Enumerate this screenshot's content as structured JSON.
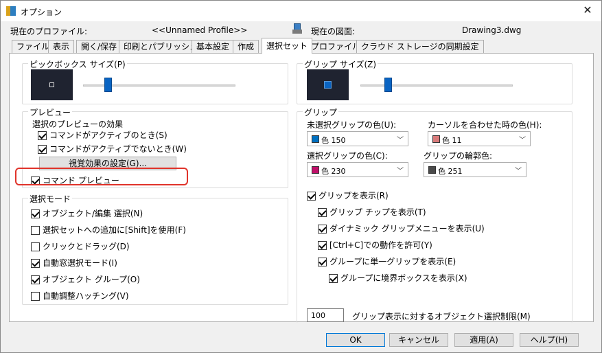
{
  "window": {
    "title": "オプション",
    "close_glyph": "✕"
  },
  "profile": {
    "label": "現在のプロファイル:",
    "value": "<<Unnamed Profile>>",
    "drawing_label": "現在の図面:",
    "drawing_value": "Drawing3.dwg"
  },
  "tabs": [
    "ファイル",
    "表示",
    "開く/保存",
    "印刷とパブリッシュ",
    "基本設定",
    "作成",
    "選択セット",
    "プロファイル",
    "クラウド ストレージの同期設定"
  ],
  "left": {
    "pickbox": {
      "title": "ピックボックス サイズ(P)",
      "slider_fraction": 0.16
    },
    "preview": {
      "title": "プレビュー",
      "subtitle": "選択のプレビューの効果",
      "active": "コマンドがアクティブのとき(S)",
      "inactive": "コマンドがアクティブでないとき(W)",
      "visual_button": "視覚効果の設定(G)...",
      "command_preview": "コマンド プレビュー"
    },
    "mode": {
      "title": "選択モード",
      "items": [
        {
          "label": "オブジェクト/編集 選択(N)",
          "checked": true
        },
        {
          "label": "選択セットへの追加に[Shift]を使用(F)",
          "checked": false
        },
        {
          "label": "クリックとドラッグ(D)",
          "checked": false
        },
        {
          "label": "自動窓選択モード(I)",
          "checked": true
        },
        {
          "label": "オブジェクト グループ(O)",
          "checked": true
        },
        {
          "label": "自動調整ハッチング(V)",
          "checked": false
        }
      ]
    }
  },
  "right": {
    "gripsize": {
      "title": "グリップ サイズ(Z)",
      "slider_fraction": 0.18
    },
    "grip": {
      "title": "グリップ",
      "unselected_label": "未選択グリップの色(U):",
      "unselected_value": "色 150",
      "unselected_color": "#0070c0",
      "hover_label": "カーソルを合わせた時の色(H):",
      "hover_value": "色 11",
      "hover_color": "#d87a7a",
      "selected_label": "選択グリップの色(C):",
      "selected_value": "色 230",
      "selected_color": "#c0106a",
      "outline_label": "グリップの輪郭色:",
      "outline_value": "色 251",
      "outline_color": "#4a4a4a",
      "checks": [
        "グリップを表示(R)",
        "グリップ チップを表示(T)",
        "ダイナミック グリップメニューを表示(U)",
        "[Ctrl+C]での動作を許可(Y)",
        "グループに単一グリップを表示(E)",
        "グループに境界ボックスを表示(X)"
      ],
      "limit_value": "100",
      "limit_label": "グリップ表示に対するオブジェクト選択制限(M)"
    }
  },
  "buttons": {
    "ok": "OK",
    "cancel": "キャンセル",
    "apply": "適用(A)",
    "help": "ヘルプ(H)"
  }
}
